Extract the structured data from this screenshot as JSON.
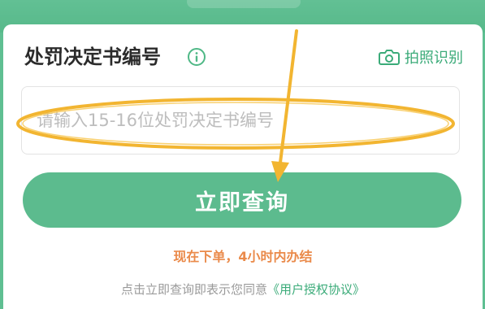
{
  "form": {
    "title": "处罚决定书编号",
    "info_icon": "info-circle-icon",
    "camera_icon": "camera-icon",
    "camera_label": "拍照识别",
    "input_placeholder": "请输入15-16位处罚决定书编号",
    "input_value": "",
    "submit_label": "立即查询",
    "promo_text": "现在下单，4小时内办结",
    "agreement_prefix": "点击立即查询即表示您同意",
    "agreement_link": "《用户授权协议》"
  },
  "annotation": {
    "shape": "ellipse-highlight-and-arrow"
  },
  "colors": {
    "brand_green": "#5cbb8e",
    "accent_green": "#3bab79",
    "promo_orange": "#ea8a4a",
    "annotation_yellow": "#f2b531",
    "title_text": "#2b2b2b",
    "muted_text": "#9a9a9a"
  }
}
